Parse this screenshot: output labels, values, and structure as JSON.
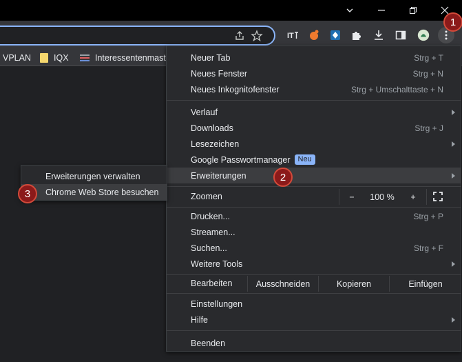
{
  "bookmarks": [
    {
      "label": "VPLAN",
      "icon": "none"
    },
    {
      "label": "IQX",
      "icon": "folder-icon"
    },
    {
      "label": "Interessentenmaste",
      "icon": "list-icon"
    }
  ],
  "menu": {
    "new_tab": {
      "label": "Neuer Tab",
      "shortcut": "Strg + T"
    },
    "new_window": {
      "label": "Neues Fenster",
      "shortcut": "Strg + N"
    },
    "incognito": {
      "label": "Neues Inkognitofenster",
      "shortcut": "Strg + Umschalttaste + N"
    },
    "history": {
      "label": "Verlauf"
    },
    "downloads": {
      "label": "Downloads",
      "shortcut": "Strg + J"
    },
    "bookmarks": {
      "label": "Lesezeichen"
    },
    "passwords": {
      "label": "Google Passwortmanager",
      "badge": "Neu"
    },
    "extensions": {
      "label": "Erweiterungen"
    },
    "zoom": {
      "label": "Zoomen",
      "minus": "−",
      "value": "100 %",
      "plus": "+"
    },
    "print": {
      "label": "Drucken...",
      "shortcut": "Strg + P"
    },
    "cast": {
      "label": "Streamen..."
    },
    "find": {
      "label": "Suchen...",
      "shortcut": "Strg + F"
    },
    "more_tools": {
      "label": "Weitere Tools"
    },
    "edit": {
      "label": "Bearbeiten",
      "cut": "Ausschneiden",
      "copy": "Kopieren",
      "paste": "Einfügen"
    },
    "settings": {
      "label": "Einstellungen"
    },
    "help": {
      "label": "Hilfe"
    },
    "exit": {
      "label": "Beenden"
    }
  },
  "submenu": {
    "manage": "Erweiterungen verwalten",
    "webstore": "Chrome Web Store besuchen"
  },
  "markers": [
    "1",
    "2",
    "3"
  ],
  "colors": {
    "menu_bg": "#292a2d",
    "highlight": "#3c3d40",
    "accent": "#8ab4f8",
    "marker": "#8b1a1a"
  }
}
